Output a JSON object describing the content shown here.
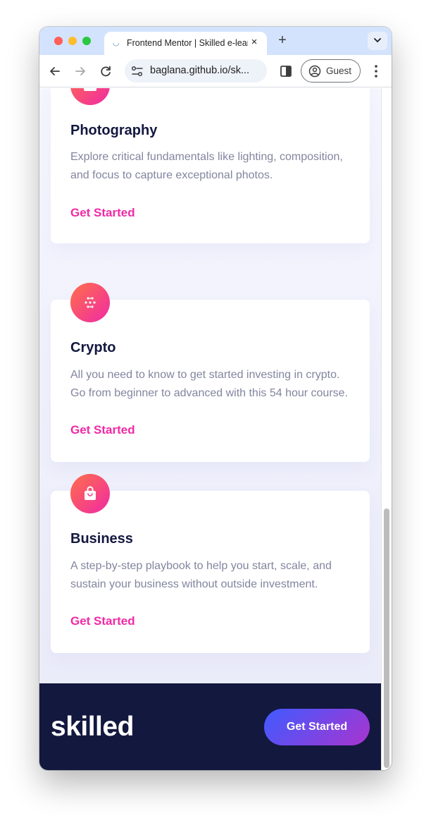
{
  "browser": {
    "tab_favicon": "frontend-mentor-favicon",
    "tab_title": "Frontend Mentor | Skilled e-learning landing page",
    "tab_close": "×",
    "new_tab": "+",
    "url": "baglana.github.io/sk...",
    "profile_label": "Guest"
  },
  "cards": [
    {
      "icon": "camera-icon",
      "title": "Photography",
      "description": "Explore critical fundamentals like lighting, composition, and focus to capture exceptional photos.",
      "link": "Get Started"
    },
    {
      "icon": "crypto-icon",
      "title": "Crypto",
      "description": "All you need to know to get started investing in crypto. Go from beginner to advanced with this 54 hour course.",
      "link": "Get Started"
    },
    {
      "icon": "shopping-bag-icon",
      "title": "Business",
      "description": "A step-by-step playbook to help you start, scale, and sustain your business without outside investment.",
      "link": "Get Started"
    }
  ],
  "footer": {
    "logo": "skilled",
    "button": "Get Started"
  },
  "colors": {
    "navy": "#13183f",
    "pink": "#f02aa6",
    "icon_gradient": [
      "#ff6f48",
      "#f02aa6"
    ],
    "button_gradient": [
      "#3f5bff",
      "#a934cf"
    ],
    "text_muted": "#83859f"
  }
}
